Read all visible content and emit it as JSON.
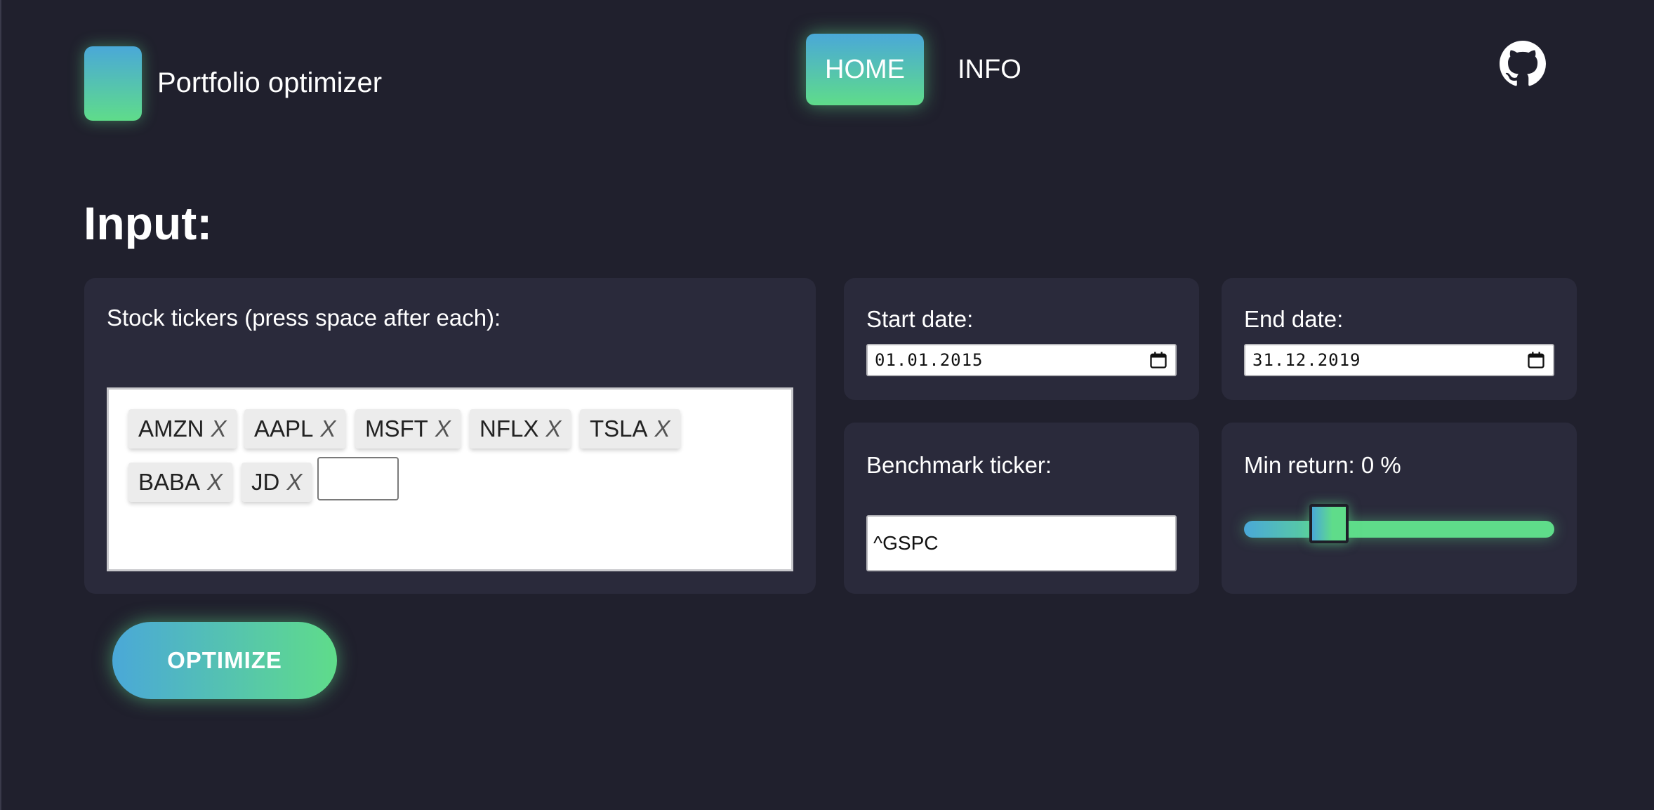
{
  "header": {
    "app_title": "Portfolio optimizer",
    "logo_gradient": [
      "#4aa8d8",
      "#5fdc8a"
    ],
    "nav": [
      {
        "label": "HOME",
        "active": true
      },
      {
        "label": "INFO",
        "active": false
      }
    ],
    "github_icon": "github-icon"
  },
  "main": {
    "title": "Input:",
    "tickers": {
      "label": "Stock tickers (press space after each):",
      "tags": [
        {
          "symbol": "AMZN",
          "remove": "X"
        },
        {
          "symbol": "AAPL",
          "remove": "X"
        },
        {
          "symbol": "MSFT",
          "remove": "X"
        },
        {
          "symbol": "NFLX",
          "remove": "X"
        },
        {
          "symbol": "TSLA",
          "remove": "X"
        },
        {
          "symbol": "BABA",
          "remove": "X"
        },
        {
          "symbol": "JD",
          "remove": "X"
        }
      ],
      "input_value": ""
    },
    "start_date": {
      "label": "Start date:",
      "value": "01.01.2015",
      "icon": "calendar-icon"
    },
    "end_date": {
      "label": "End date:",
      "value": "31.12.2019",
      "icon": "calendar-icon"
    },
    "benchmark": {
      "label": "Benchmark ticker:",
      "value": "^GSPC"
    },
    "min_return": {
      "label": "Min return: 0 %",
      "slider_fraction": 0.24
    },
    "optimize_button": "OPTIMIZE"
  },
  "colors": {
    "background": "#20202d",
    "card": "#2a2a3b",
    "accent_start": "#4aa8d8",
    "accent_end": "#5fdc8a"
  }
}
